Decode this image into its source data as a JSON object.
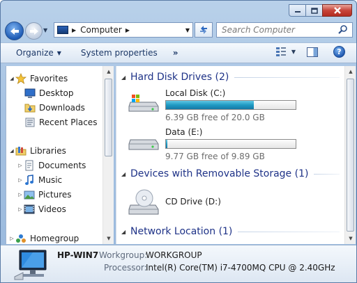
{
  "window": {
    "caption_buttons": [
      "minimize",
      "maximize",
      "close"
    ]
  },
  "nav": {
    "breadcrumb": [
      "Computer"
    ],
    "search_placeholder": "Search Computer"
  },
  "toolbar": {
    "organize": "Organize",
    "system_properties": "System properties",
    "more": "»"
  },
  "sidebar": {
    "favorites": {
      "label": "Favorites",
      "items": [
        {
          "label": "Desktop",
          "icon": "desktop-icon"
        },
        {
          "label": "Downloads",
          "icon": "downloads-folder-icon"
        },
        {
          "label": "Recent Places",
          "icon": "recent-places-icon"
        }
      ]
    },
    "libraries": {
      "label": "Libraries",
      "items": [
        {
          "label": "Documents",
          "icon": "documents-icon"
        },
        {
          "label": "Music",
          "icon": "music-icon"
        },
        {
          "label": "Pictures",
          "icon": "pictures-icon"
        },
        {
          "label": "Videos",
          "icon": "videos-icon"
        }
      ]
    },
    "homegroup": {
      "label": "Homegroup"
    }
  },
  "content": {
    "groups": [
      {
        "title": "Hard Disk Drives (2)"
      },
      {
        "title": "Devices with Removable Storage (1)"
      },
      {
        "title": "Network Location (1)"
      }
    ],
    "drives": [
      {
        "name": "Local Disk (C:)",
        "free_text": "6.39 GB free of 20.0 GB",
        "used_fraction": 0.68,
        "icon": "windows-drive-icon"
      },
      {
        "name": "Data (E:)",
        "free_text": "9.77 GB free of 9.89 GB",
        "used_fraction": 0.012,
        "icon": "hard-drive-icon"
      }
    ],
    "removable": [
      {
        "name": "CD Drive (D:)",
        "icon": "cd-drive-icon"
      }
    ]
  },
  "details": {
    "computer_name": "HP-WIN7",
    "workgroup_label": "Workgroup:",
    "workgroup_value": "WORKGROUP",
    "processor_label": "Processor:",
    "processor_value": "Intel(R) Core(TM) i7-4700MQ CPU @ 2.40GHz"
  },
  "colors": {
    "group_header": "#1e3287",
    "usage_bar": "#26a0da",
    "window_frame": "#a6c2e2"
  }
}
